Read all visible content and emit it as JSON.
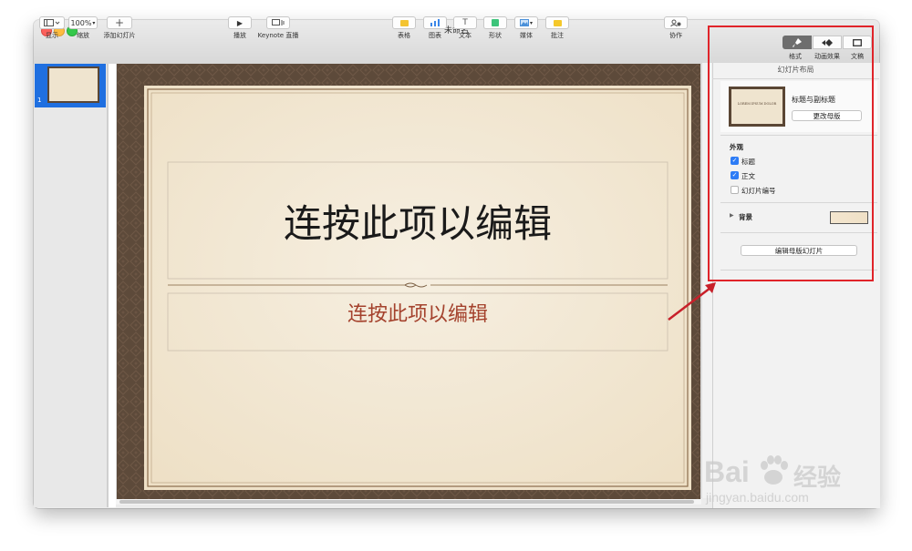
{
  "window": {
    "title": "未命名"
  },
  "toolbar": {
    "view": {
      "label": "显示"
    },
    "zoom": {
      "value": "100%",
      "label": "缩放"
    },
    "add_slide": {
      "label": "添加幻灯片"
    },
    "play": {
      "label": "播放"
    },
    "keynote_live": {
      "label": "Keynote 直播"
    },
    "table": {
      "label": "表格",
      "color": "#f4c430"
    },
    "chart": {
      "label": "图表",
      "color": "#3a86e8"
    },
    "text": {
      "label": "文本"
    },
    "shape": {
      "label": "形状",
      "color": "#3cc47a"
    },
    "media": {
      "label": "媒体",
      "color": "#4a90d9"
    },
    "comment": {
      "label": "批注",
      "color": "#f5c82a"
    },
    "collaborate": {
      "label": "协作"
    },
    "format_tab": {
      "label": "格式"
    },
    "animate_tab": {
      "label": "动画效果"
    },
    "document_tab": {
      "label": "文稿"
    }
  },
  "navigator": {
    "slide_number": "1"
  },
  "slide": {
    "title_placeholder": "连按此项以编辑",
    "subtitle_placeholder": "连按此项以编辑",
    "title_color": "#1a1a1a",
    "subtitle_color": "#a4422d"
  },
  "inspector": {
    "panel_title": "幻灯片布局",
    "layout_name": "标题与副标题",
    "change_master_button": "更改母版",
    "thumb_text": "LOREM IPSUM DOLOR",
    "appearance_heading": "外观",
    "checkbox_title": {
      "label": "标题",
      "checked": true
    },
    "checkbox_body": {
      "label": "正文",
      "checked": true
    },
    "checkbox_slide_number": {
      "label": "幻灯片编号",
      "checked": false
    },
    "background_label": "背景",
    "edit_master_button": "编辑母版幻灯片"
  },
  "watermark": {
    "brand_left": "Bai",
    "brand_right": "经验",
    "url": "jingyan.baidu.com"
  }
}
